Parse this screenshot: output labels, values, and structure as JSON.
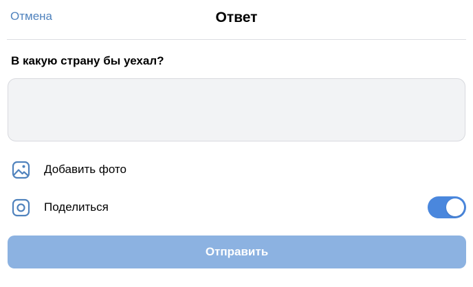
{
  "header": {
    "cancel_label": "Отмена",
    "title": "Ответ"
  },
  "question": {
    "text": "В какую страну бы уехал?"
  },
  "answer": {
    "value": "",
    "placeholder": ""
  },
  "options": {
    "add_photo": {
      "label": "Добавить фото",
      "icon": "image-icon"
    },
    "share": {
      "label": "Поделиться",
      "icon": "instagram-icon",
      "toggle_on": true
    }
  },
  "submit": {
    "label": "Отправить"
  },
  "colors": {
    "accent": "#4a87dd",
    "link": "#4f82bd",
    "submit_disabled": "#8cb2e1",
    "input_bg": "#f2f3f5"
  }
}
